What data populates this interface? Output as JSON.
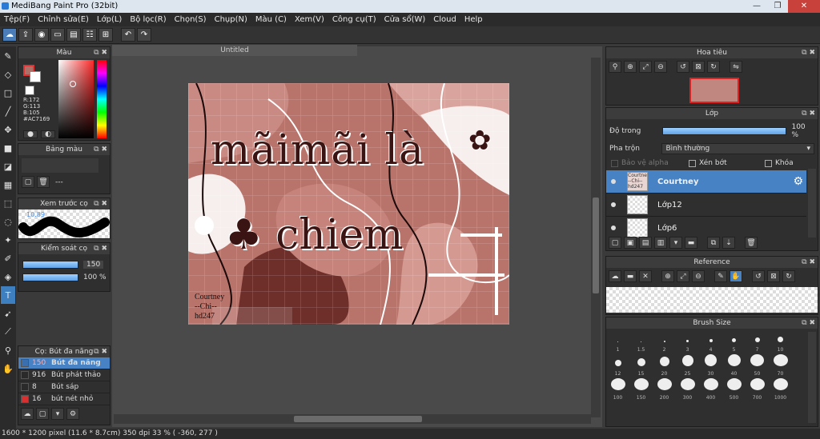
{
  "window": {
    "title": "MediBang Paint Pro (32bit)",
    "min": "—",
    "max": "❐",
    "close": "✕"
  },
  "menu": [
    "Tệp(F)",
    "Chỉnh sửa(E)",
    "Lớp(L)",
    "Bộ lọc(R)",
    "Chọn(S)",
    "Chụp(N)",
    "Màu (C)",
    "Xem(V)",
    "Công cụ(T)",
    "Cửa sổ(W)",
    "Cloud",
    "Help"
  ],
  "doc_tab": "Untitled",
  "color_panel": {
    "title": "Màu",
    "r": "R:172",
    "g": "G:113",
    "b": "B:105",
    "hex": "#AC7169",
    "main_color": "#ac7169"
  },
  "swatch_panel": {
    "title": "Bảng màu",
    "empty": "---"
  },
  "preview_panel": {
    "title": "Xem trước cọ",
    "size": "10.89"
  },
  "control_panel": {
    "title": "Kiểm soát cọ",
    "size": "150",
    "opacity": "100 %"
  },
  "brush_panel": {
    "title": "Cọ: Bút đa năng",
    "items": [
      {
        "size": "150",
        "name": "Bút đa năng",
        "color": "#3a6fb0"
      },
      {
        "size": "916",
        "name": "Bút phát thảo",
        "color": "#2a2a2a"
      },
      {
        "size": "8",
        "name": "Bút sáp",
        "color": "#2a2a2a"
      },
      {
        "size": "16",
        "name": "bút nét nhỏ",
        "color": "#d83030"
      }
    ]
  },
  "navigator": {
    "title": "Hoa tiêu"
  },
  "layer_panel": {
    "title": "Lớp",
    "opacity_label": "Độ trong",
    "opacity_value": "100 %",
    "opacity": 1.0,
    "blend_label": "Pha trộn",
    "blend_value": "Bình thường",
    "protect_alpha": "Bảo vệ alpha",
    "clip": "Xén bớt",
    "lock": "Khóa",
    "layers": [
      {
        "name": "Courtney",
        "thumb": "Courtney --Chi-- hd247",
        "selected": true
      },
      {
        "name": "Lớp12",
        "thumb": "",
        "selected": false
      },
      {
        "name": "Lớp6",
        "thumb": "",
        "selected": false
      }
    ]
  },
  "reference_panel": {
    "title": "Reference"
  },
  "brush_size_panel": {
    "title": "Brush Size",
    "sizes": [
      "1",
      "1.5",
      "2",
      "3",
      "4",
      "5",
      "7",
      "10",
      "12",
      "15",
      "20",
      "25",
      "30",
      "40",
      "50",
      "70",
      "100",
      "150",
      "200",
      "300",
      "400",
      "500",
      "700",
      "1000"
    ]
  },
  "artwork": {
    "line1": "mãimãi là",
    "line2": "♣ chiem",
    "sig1": "Courtney",
    "sig2": "--Chi--",
    "sig3": "hd247"
  },
  "status": "1600 * 1200 pixel   (11.6 * 8.7cm)   350 dpi   33 %   ( -360, 277 )"
}
